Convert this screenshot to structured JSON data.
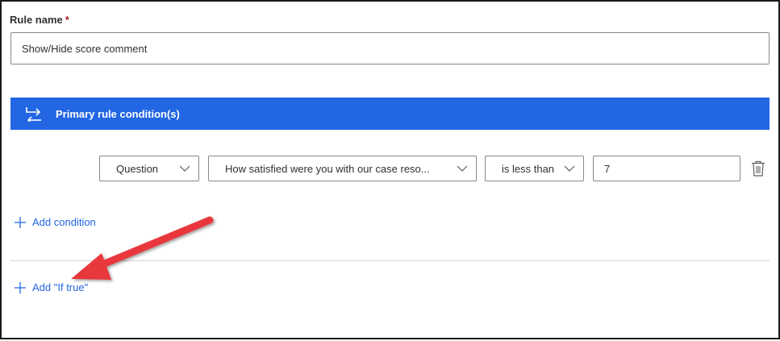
{
  "rule": {
    "label": "Rule name",
    "required_mark": "*",
    "value": "Show/Hide score comment"
  },
  "banner": {
    "icon": "swap-arrows-icon",
    "title": "Primary rule condition(s)",
    "color": "#2266e3"
  },
  "condition": {
    "field_type": "Question",
    "question": "How satisfied were you with our case reso...",
    "operator": "is less than",
    "value": "7",
    "delete_icon": "trash-icon"
  },
  "actions": {
    "add_condition": "Add condition",
    "add_if_true": "Add \"If true\""
  },
  "annotation": {
    "arrow_color": "#e8393c"
  }
}
